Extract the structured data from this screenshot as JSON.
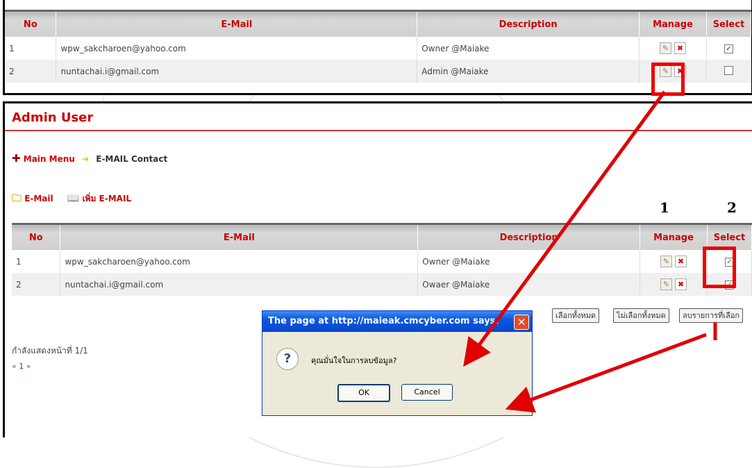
{
  "columns": {
    "no": "No",
    "email": "E-Mail",
    "description": "Description",
    "manage": "Manage",
    "select": "Select"
  },
  "top_table": {
    "rows": [
      {
        "no": "1",
        "email": "wpw_sakcharoen@yahoo.com",
        "description": "Owner @Maiake",
        "checked": true
      },
      {
        "no": "2",
        "email": "nuntachai.i@gmail.com",
        "description": "Admin @Maiake",
        "checked": false
      }
    ]
  },
  "page": {
    "title": "Admin User",
    "breadcrumb_main": "Main Menu",
    "breadcrumb_current": "E-MAIL Contact",
    "tool_email": "E-Mail",
    "tool_add": "เพิ่ม E-MAIL",
    "step1": "1",
    "step2": "2",
    "rows": [
      {
        "no": "1",
        "email": "wpw_sakcharoen@yahoo.com",
        "description": "Owner @Maiake",
        "checked": true
      },
      {
        "no": "2",
        "email": "nuntachai.i@gmail.com",
        "description": "Owaer @Maiake",
        "checked": true
      }
    ],
    "btn_select_all": "เลือกทั้งหมด",
    "btn_deselect_all": "ไม่เลือกทั้งหมด",
    "btn_delete_selected": "ลบรายการที่เลือก",
    "paging_text": "กำลังแสดงหน้าที่ 1/1",
    "pager_prev": "«",
    "pager_page": "1",
    "pager_next": "»"
  },
  "dialog": {
    "title": "The page at http://maieak.cmcyber.com says:",
    "message": "คุณมั่นใจในการลบข้อมูล?",
    "ok": "OK",
    "cancel": "Cancel"
  },
  "colors": {
    "accent_red": "#cc0000",
    "arrow_red": "#e00000",
    "header_bg": "#c8c8c8"
  }
}
